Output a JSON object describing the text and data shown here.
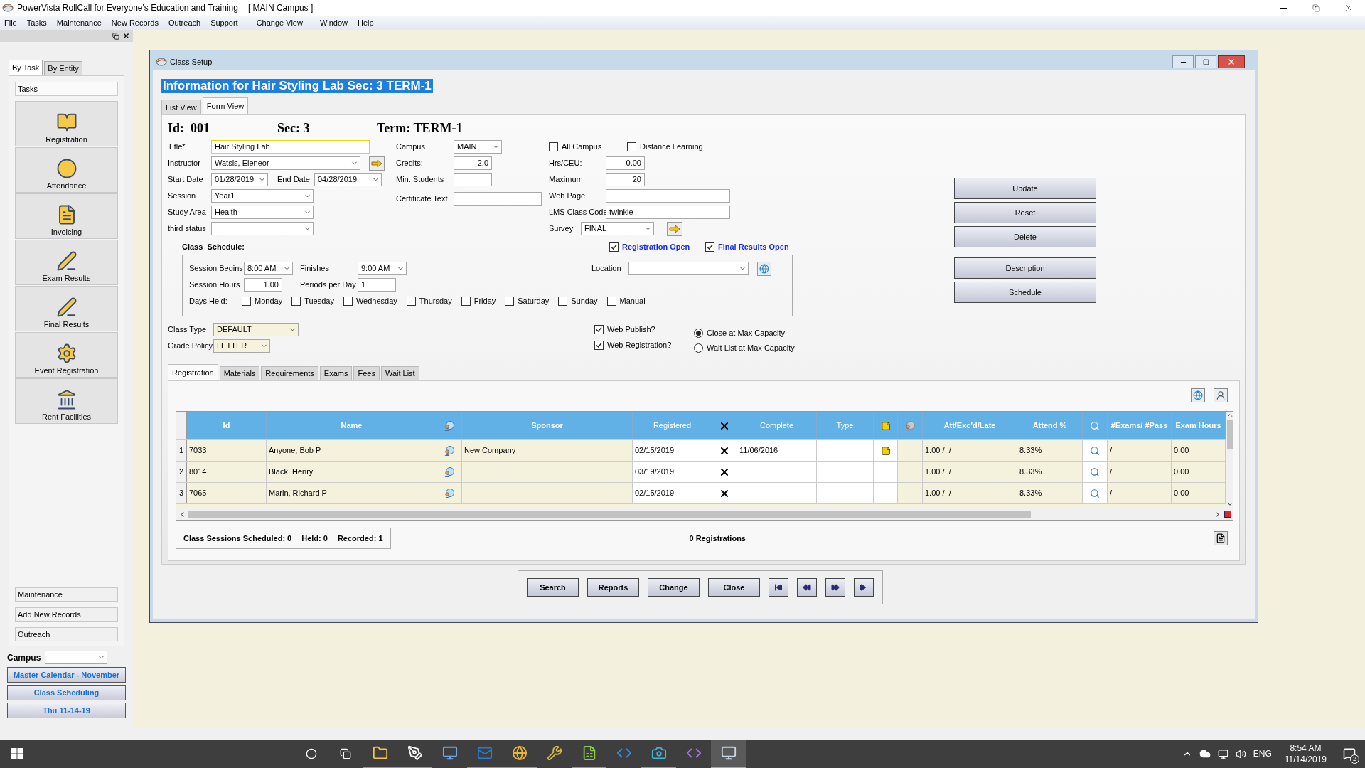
{
  "app": {
    "title": "PowerVista RollCall for Everyone's Education and Training",
    "campus": "[ MAIN Campus ]"
  },
  "menu": [
    "File",
    "Tasks",
    "Maintenance",
    "New Records",
    "Outreach",
    "Support",
    "Change View",
    "Window",
    "Help"
  ],
  "sidebar": {
    "tabs": [
      {
        "label": "By Task",
        "selected": true
      },
      {
        "label": "By Entity",
        "selected": false
      }
    ],
    "section": "Tasks",
    "tasks": [
      "Registration",
      "Attendance",
      "Invoicing",
      "Exam Results",
      "Final Results",
      "Event Registration",
      "Rent Facilities"
    ],
    "groups": [
      "Maintenance",
      "Add New Records",
      "Outreach"
    ],
    "campus_label": "Campus",
    "links": [
      "Master Calendar - November",
      "Class Scheduling",
      "Thu 11-14-19"
    ]
  },
  "form": {
    "title": "Class Setup",
    "heading": "Information for Hair Styling Lab Sec: 3 TERM-1",
    "view_tabs": [
      {
        "label": "List View",
        "selected": false
      },
      {
        "label": "Form View",
        "selected": true
      }
    ],
    "id": "Id:  001",
    "sec": "Sec: 3",
    "term": "Term: TERM-1",
    "fields": {
      "title": {
        "label": "Title*",
        "value": "Hair Styling Lab"
      },
      "instructor": {
        "label": "Instructor",
        "value": "Watsis, Eleneor"
      },
      "start_date": {
        "label": "Start Date",
        "value": "01/28/2019"
      },
      "end_date": {
        "label": "End Date",
        "value": "04/28/2019"
      },
      "session": {
        "label": "Session",
        "value": "Year1"
      },
      "study_area": {
        "label": "Study Area",
        "value": "Health"
      },
      "third_status": {
        "label": "third status"
      },
      "campus": {
        "label": "Campus",
        "value": "MAIN"
      },
      "credits": {
        "label": "Credits:",
        "value": "2.0"
      },
      "min_students": {
        "label": "Min. Students"
      },
      "certificate_text": {
        "label": "Certificate Text"
      },
      "all_campus": {
        "label": "All Campus",
        "checked": false
      },
      "distance_learning": {
        "label": "Distance Learning",
        "checked": false
      },
      "hrs_ceu": {
        "label": "Hrs/CEU:",
        "value": "0.00"
      },
      "maximum": {
        "label": "Maximum",
        "value": "20"
      },
      "web_page": {
        "label": "Web Page"
      },
      "lms_class_code": {
        "label": "LMS Class Code",
        "value": "twinkie"
      },
      "survey": {
        "label": "Survey",
        "value": "FINAL"
      }
    },
    "schedule": {
      "label": "Class  Schedule:",
      "registration_open": {
        "label": "Registration Open",
        "checked": true
      },
      "final_results_open": {
        "label": "Final Results Open",
        "checked": true
      },
      "session_begins": {
        "label": "Session Begins",
        "value": "8:00 AM"
      },
      "finishes": {
        "label": "Finishes",
        "value": "9:00 AM"
      },
      "session_hours": {
        "label": "Session Hours",
        "value": "1.00"
      },
      "periods_per_day": {
        "label": "Periods per Day",
        "value": "1"
      },
      "location": {
        "label": "Location"
      },
      "days_label": "Days Held:",
      "days": [
        {
          "label": "Monday",
          "checked": false
        },
        {
          "label": "Tuesday",
          "checked": false
        },
        {
          "label": "Wednesday",
          "checked": false
        },
        {
          "label": "Thursday",
          "checked": false
        },
        {
          "label": "Friday",
          "checked": false
        },
        {
          "label": "Saturday",
          "checked": false
        },
        {
          "label": "Sunday",
          "checked": false
        },
        {
          "label": "Manual",
          "checked": false
        }
      ]
    },
    "class_type": {
      "label": "Class Type",
      "value": "DEFAULT"
    },
    "grade_policy": {
      "label": "Grade Policy",
      "value": "LETTER"
    },
    "web_publish": {
      "label": "Web Publish?",
      "checked": true
    },
    "web_registration": {
      "label": "Web Registration?",
      "checked": true
    },
    "capacity": [
      {
        "label": "Close at Max Capacity",
        "selected": true
      },
      {
        "label": "Wait List at Max Capacity",
        "selected": false
      }
    ],
    "actions": [
      "Update",
      "Reset",
      "Delete",
      "Description",
      "Schedule"
    ],
    "detail_tabs": [
      {
        "label": "Registration",
        "selected": true
      },
      {
        "label": "Materials",
        "selected": false
      },
      {
        "label": "Requirements",
        "selected": false
      },
      {
        "label": "Exams",
        "selected": false
      },
      {
        "label": "Fees",
        "selected": false
      },
      {
        "label": "Wait List",
        "selected": false
      }
    ],
    "grid": {
      "row_numbers": [
        "1",
        "2",
        "3"
      ],
      "columns": [
        {
          "kind": "text",
          "label": "Id",
          "cells": [
            "7033",
            "8014",
            "7065"
          ]
        },
        {
          "kind": "text",
          "label": "Name",
          "cells": [
            "Anyone, Bob P",
            "Black, Henry",
            "Marin, Richard P"
          ]
        },
        {
          "kind": "person"
        },
        {
          "kind": "text",
          "label": "Sponsor",
          "cells": [
            "New Company"
          ]
        },
        {
          "kind": "text",
          "label": "Registered",
          "cells": [
            "02/15/2019",
            "03/19/2019",
            "02/15/2019"
          ]
        },
        {
          "kind": "delete"
        },
        {
          "kind": "text",
          "label": "Complete",
          "cells": [
            "11/06/2016"
          ]
        },
        {
          "kind": "text",
          "label": "Type"
        },
        {
          "kind": "note",
          "notes": [
            true,
            false,
            false
          ]
        },
        {
          "kind": "contact"
        },
        {
          "kind": "text",
          "label": "Att/Exc'd/Late",
          "cells": [
            "1.00 /  /",
            "1.00 /  /",
            "1.00 /  /"
          ]
        },
        {
          "kind": "text",
          "label": "Attend %",
          "cells": [
            "8.33%",
            "8.33%",
            "8.33%"
          ]
        },
        {
          "kind": "search"
        },
        {
          "kind": "text",
          "label": "#Exams/ #Pass",
          "cells": [
            "/",
            "/",
            "/"
          ]
        },
        {
          "kind": "text",
          "label": "Exam Hours",
          "cells": [
            "0.00",
            "0.00",
            "0.00"
          ]
        }
      ]
    },
    "summary": {
      "scheduled": "Class Sessions Scheduled: 0",
      "held": "Held: 0",
      "recorded": "Recorded: 1",
      "registrations": "0 Registrations"
    },
    "bottom_buttons": [
      "Search",
      "Reports",
      "Change",
      "Close"
    ]
  },
  "taskbar": {
    "language": "ENG",
    "time": "8:54 AM",
    "date": "11/14/2019",
    "notifications": "2"
  }
}
